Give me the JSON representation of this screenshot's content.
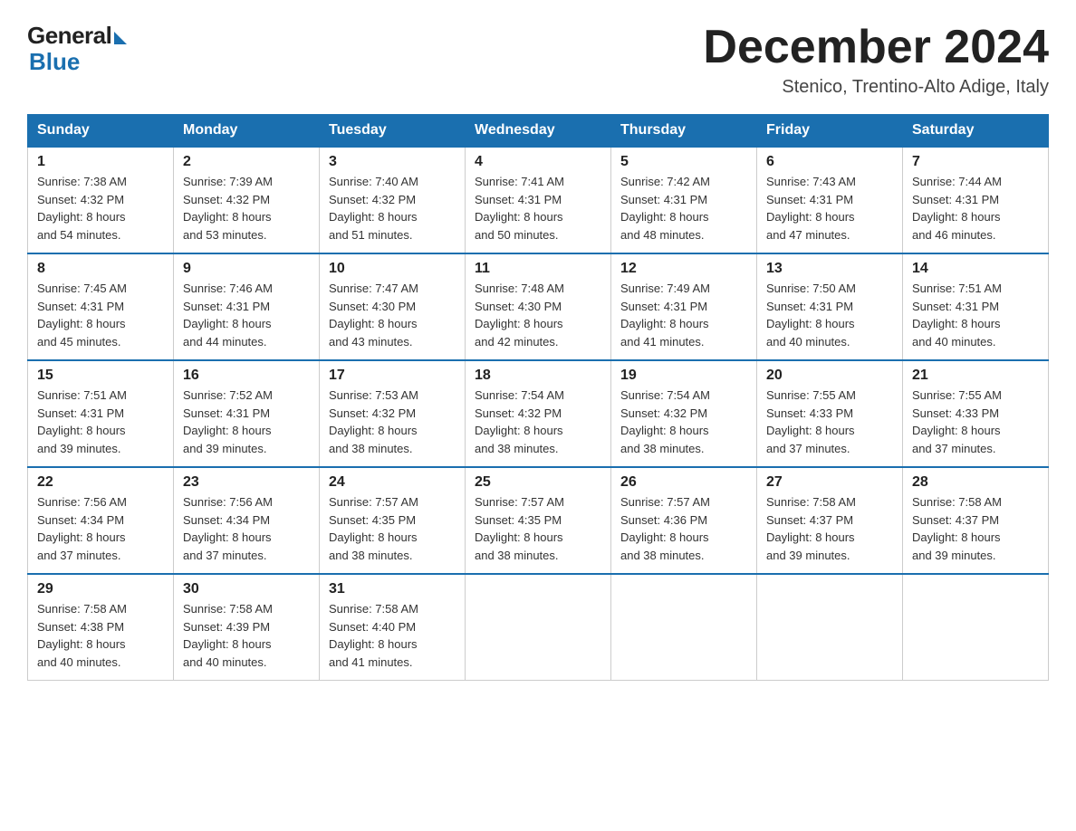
{
  "logo": {
    "general": "General",
    "blue": "Blue"
  },
  "header": {
    "month": "December 2024",
    "location": "Stenico, Trentino-Alto Adige, Italy"
  },
  "days_of_week": [
    "Sunday",
    "Monday",
    "Tuesday",
    "Wednesday",
    "Thursday",
    "Friday",
    "Saturday"
  ],
  "weeks": [
    [
      {
        "day": "1",
        "sunrise": "7:38 AM",
        "sunset": "4:32 PM",
        "daylight": "8 hours and 54 minutes."
      },
      {
        "day": "2",
        "sunrise": "7:39 AM",
        "sunset": "4:32 PM",
        "daylight": "8 hours and 53 minutes."
      },
      {
        "day": "3",
        "sunrise": "7:40 AM",
        "sunset": "4:32 PM",
        "daylight": "8 hours and 51 minutes."
      },
      {
        "day": "4",
        "sunrise": "7:41 AM",
        "sunset": "4:31 PM",
        "daylight": "8 hours and 50 minutes."
      },
      {
        "day": "5",
        "sunrise": "7:42 AM",
        "sunset": "4:31 PM",
        "daylight": "8 hours and 48 minutes."
      },
      {
        "day": "6",
        "sunrise": "7:43 AM",
        "sunset": "4:31 PM",
        "daylight": "8 hours and 47 minutes."
      },
      {
        "day": "7",
        "sunrise": "7:44 AM",
        "sunset": "4:31 PM",
        "daylight": "8 hours and 46 minutes."
      }
    ],
    [
      {
        "day": "8",
        "sunrise": "7:45 AM",
        "sunset": "4:31 PM",
        "daylight": "8 hours and 45 minutes."
      },
      {
        "day": "9",
        "sunrise": "7:46 AM",
        "sunset": "4:31 PM",
        "daylight": "8 hours and 44 minutes."
      },
      {
        "day": "10",
        "sunrise": "7:47 AM",
        "sunset": "4:30 PM",
        "daylight": "8 hours and 43 minutes."
      },
      {
        "day": "11",
        "sunrise": "7:48 AM",
        "sunset": "4:30 PM",
        "daylight": "8 hours and 42 minutes."
      },
      {
        "day": "12",
        "sunrise": "7:49 AM",
        "sunset": "4:31 PM",
        "daylight": "8 hours and 41 minutes."
      },
      {
        "day": "13",
        "sunrise": "7:50 AM",
        "sunset": "4:31 PM",
        "daylight": "8 hours and 40 minutes."
      },
      {
        "day": "14",
        "sunrise": "7:51 AM",
        "sunset": "4:31 PM",
        "daylight": "8 hours and 40 minutes."
      }
    ],
    [
      {
        "day": "15",
        "sunrise": "7:51 AM",
        "sunset": "4:31 PM",
        "daylight": "8 hours and 39 minutes."
      },
      {
        "day": "16",
        "sunrise": "7:52 AM",
        "sunset": "4:31 PM",
        "daylight": "8 hours and 39 minutes."
      },
      {
        "day": "17",
        "sunrise": "7:53 AM",
        "sunset": "4:32 PM",
        "daylight": "8 hours and 38 minutes."
      },
      {
        "day": "18",
        "sunrise": "7:54 AM",
        "sunset": "4:32 PM",
        "daylight": "8 hours and 38 minutes."
      },
      {
        "day": "19",
        "sunrise": "7:54 AM",
        "sunset": "4:32 PM",
        "daylight": "8 hours and 38 minutes."
      },
      {
        "day": "20",
        "sunrise": "7:55 AM",
        "sunset": "4:33 PM",
        "daylight": "8 hours and 37 minutes."
      },
      {
        "day": "21",
        "sunrise": "7:55 AM",
        "sunset": "4:33 PM",
        "daylight": "8 hours and 37 minutes."
      }
    ],
    [
      {
        "day": "22",
        "sunrise": "7:56 AM",
        "sunset": "4:34 PM",
        "daylight": "8 hours and 37 minutes."
      },
      {
        "day": "23",
        "sunrise": "7:56 AM",
        "sunset": "4:34 PM",
        "daylight": "8 hours and 37 minutes."
      },
      {
        "day": "24",
        "sunrise": "7:57 AM",
        "sunset": "4:35 PM",
        "daylight": "8 hours and 38 minutes."
      },
      {
        "day": "25",
        "sunrise": "7:57 AM",
        "sunset": "4:35 PM",
        "daylight": "8 hours and 38 minutes."
      },
      {
        "day": "26",
        "sunrise": "7:57 AM",
        "sunset": "4:36 PM",
        "daylight": "8 hours and 38 minutes."
      },
      {
        "day": "27",
        "sunrise": "7:58 AM",
        "sunset": "4:37 PM",
        "daylight": "8 hours and 39 minutes."
      },
      {
        "day": "28",
        "sunrise": "7:58 AM",
        "sunset": "4:37 PM",
        "daylight": "8 hours and 39 minutes."
      }
    ],
    [
      {
        "day": "29",
        "sunrise": "7:58 AM",
        "sunset": "4:38 PM",
        "daylight": "8 hours and 40 minutes."
      },
      {
        "day": "30",
        "sunrise": "7:58 AM",
        "sunset": "4:39 PM",
        "daylight": "8 hours and 40 minutes."
      },
      {
        "day": "31",
        "sunrise": "7:58 AM",
        "sunset": "4:40 PM",
        "daylight": "8 hours and 41 minutes."
      },
      null,
      null,
      null,
      null
    ]
  ],
  "labels": {
    "sunrise": "Sunrise:",
    "sunset": "Sunset:",
    "daylight": "Daylight:"
  },
  "colors": {
    "header_bg": "#1a6faf",
    "header_text": "#ffffff",
    "border": "#1a6faf"
  }
}
